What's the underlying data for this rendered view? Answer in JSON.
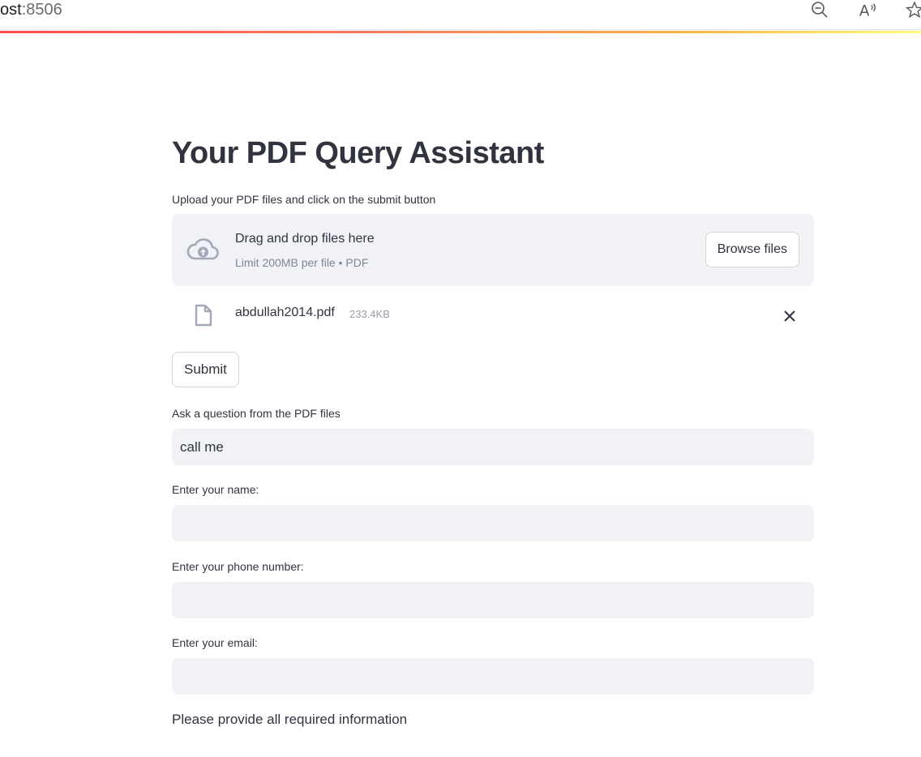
{
  "browser": {
    "url_host": "ost",
    "url_port": ":8506",
    "icons": [
      "zoom-out-icon",
      "read-aloud-icon",
      "favorite-star-icon"
    ]
  },
  "colors": {
    "accent_gradient": [
      "#ff4b4b",
      "#ffb347",
      "#fffd80"
    ],
    "input_bg": "#f0f2f6",
    "text": "#31333f",
    "muted": "#808495"
  },
  "page": {
    "title": "Your PDF Query Assistant"
  },
  "uploader": {
    "label": "Upload your PDF files and click on the submit button",
    "drop_title": "Drag and drop files here",
    "drop_subtitle": "Limit 200MB per file • PDF",
    "browse_label": "Browse files",
    "files": [
      {
        "name": "abdullah2014.pdf",
        "size": "233.4KB"
      }
    ]
  },
  "submit": {
    "label": "Submit"
  },
  "question": {
    "label": "Ask a question from the PDF files",
    "value": "call me"
  },
  "name_field": {
    "label": "Enter your name:",
    "value": ""
  },
  "phone_field": {
    "label": "Enter your phone number:",
    "value": ""
  },
  "email_field": {
    "label": "Enter your email:",
    "value": ""
  },
  "status": {
    "message": "Please provide all required information"
  }
}
